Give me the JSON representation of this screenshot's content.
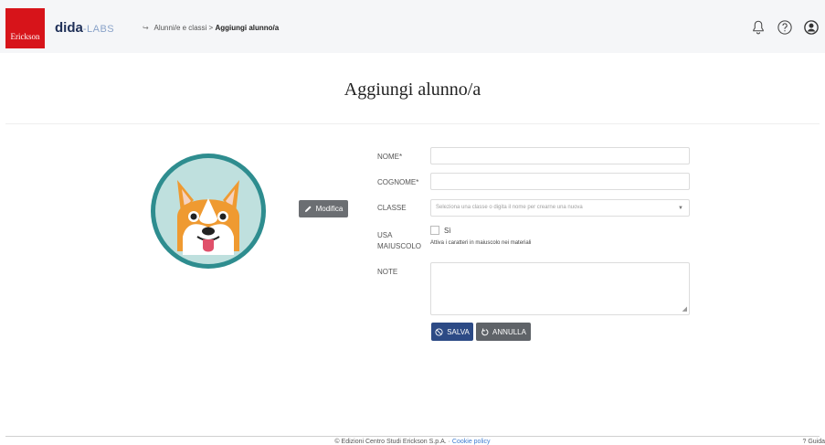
{
  "header": {
    "logo_text": "Erickson",
    "brand_name": "dida",
    "brand_suffix": "-LABS",
    "breadcrumb": {
      "parent": "Alunni/e e classi",
      "separator": ">",
      "current": "Aggiungi alunno/a"
    },
    "icons": [
      "bell-icon",
      "help-icon",
      "user-icon"
    ]
  },
  "page": {
    "title": "Aggiungi alunno/a"
  },
  "avatar": {
    "edit_label": "Modifica",
    "edit_icon": "pencil-icon"
  },
  "form": {
    "nome_label": "NOME*",
    "nome_value": "",
    "cognome_label": "COGNOME*",
    "cognome_value": "",
    "classe_label": "CLASSE",
    "classe_placeholder": "Seleziona una classe o digita il nome per crearne una nuova",
    "maiuscolo_label_1": "USA",
    "maiuscolo_label_2": "MAIUSCOLO",
    "maiuscolo_option": "Sì",
    "maiuscolo_checked": false,
    "maiuscolo_hint": "Attiva i caratteri in maiuscolo nei materiali",
    "note_label": "NOTE",
    "note_value": ""
  },
  "actions": {
    "save_label": "SALVA",
    "cancel_label": "ANNULLA"
  },
  "footer": {
    "copyright": "© Edizioni Centro Studi Erickson S.p.A. ·",
    "cookie_label": "Cookie policy",
    "help_label": "Guida"
  },
  "colors": {
    "brand_red": "#d7141a",
    "save_blue": "#2c4a85",
    "modifica_gray": "#6b6e72",
    "avatar_teal": "#2e8d8f",
    "dog_orange": "#ef9a31"
  }
}
